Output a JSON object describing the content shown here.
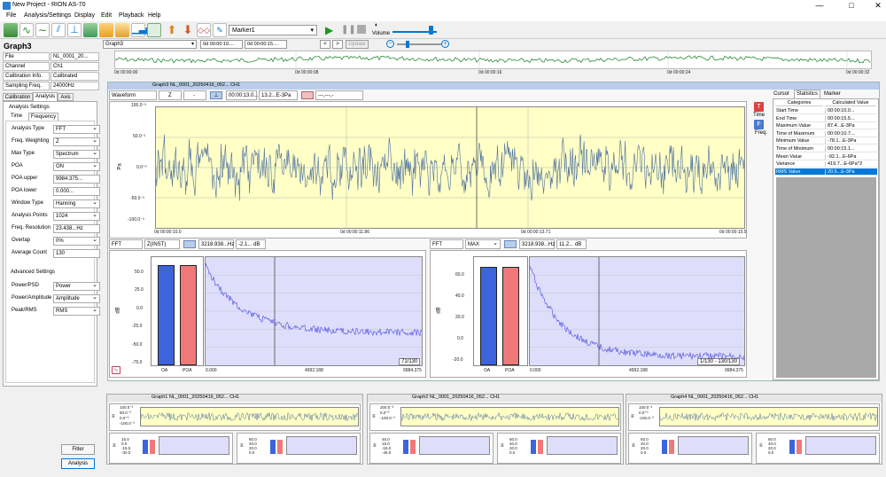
{
  "window": {
    "title": "New Project - RION AS-70",
    "min": "—",
    "max": "□",
    "close": "✕"
  },
  "menu": [
    "File",
    "Analysis/Settings",
    "Display",
    "Edit",
    "Playback",
    "Help"
  ],
  "toolbar": {
    "marker_select": "Marker1",
    "volume_label": "Volume"
  },
  "overview": {
    "graph_select": "Graph3",
    "time_box": "0d 00:00:10....",
    "time_box2": "0d 00:00:15....",
    "update": "Update",
    "ticks": [
      "0d 00:00:00",
      "0d 00:00:08",
      "0d 00:00:16",
      "0d 00:00:24",
      "0d 00:00:32"
    ]
  },
  "left": {
    "title": "Graph3",
    "info": [
      {
        "k": "File",
        "v": "NL_0001_20..."
      },
      {
        "k": "Channel",
        "v": "Ch1"
      },
      {
        "k": "Calibration Info.",
        "v": "Calibrated"
      },
      {
        "k": "Sampling Freq.",
        "v": "24000Hz"
      }
    ],
    "tabs": [
      "Calibration",
      "Analysis",
      "Axis"
    ],
    "section": "Analysis Settings",
    "subtabs": [
      "Time",
      "Frequency"
    ],
    "settings": [
      {
        "k": "Analysis Type",
        "v": "FFT"
      },
      {
        "k": "Freq. Weighting",
        "v": "Z"
      },
      {
        "k": "Max Type",
        "v": "Spectrum"
      },
      {
        "k": "POA",
        "v": "ON"
      },
      {
        "k": "POA upper",
        "v": "9984.375..."
      },
      {
        "k": "POA lower",
        "v": "0.000..."
      },
      {
        "k": "Window Type",
        "v": "Hanning"
      },
      {
        "k": "Analysis Points",
        "v": "1024"
      },
      {
        "k": "Freq. Resolution",
        "v": "23.438...Hz"
      },
      {
        "k": "Overlap",
        "v": "0%"
      },
      {
        "k": "Average Count",
        "v": "130"
      }
    ],
    "adv_title": "Advanced Settings",
    "advanced": [
      {
        "k": "Power/PSD",
        "v": "Power"
      },
      {
        "k": "Power/Amplitude",
        "v": "Amplitude"
      },
      {
        "k": "Peak/RMS",
        "v": "RMS"
      }
    ],
    "filter_btn": "Filter",
    "analysis_btn": "Analysis"
  },
  "graph3": {
    "title": "Graph3 NL_0001_20250416_052... CH1",
    "type": "Waveform",
    "weight": "Z",
    "dash": "-",
    "time": "00:00:13.0...",
    "value": "13.2...E-3Pa",
    "dashes": "---,---,-",
    "yticks": [
      "100.0⁻³",
      "50.0⁻³",
      "0.0⁺⁰",
      "-50.0⁻³",
      "-100.0⁻³"
    ],
    "xticks": [
      "0d 00:00:10.0",
      "0d 00:00:11.86",
      "0d 00:00:13.71",
      "0d 00:00:15.5"
    ],
    "ylabel": "Pa",
    "time_btn": "Time",
    "freq_btn": "Freq."
  },
  "fft1": {
    "type": "FFT",
    "weight": "Z(INST)",
    "freq": "3218.938...Hz",
    "db": "-2.1... dB",
    "yticks": [
      "50.0",
      "25.0",
      "0.0",
      "-25.0",
      "-50.0",
      "-75.0"
    ],
    "xticks": [
      "0.000",
      "4992.188",
      "9984.375"
    ],
    "bars": [
      "OA",
      "POA"
    ],
    "counter": "71/130",
    "ylabel": "dB"
  },
  "fft2": {
    "type": "FFT",
    "weight": "MAX",
    "freq": "3218.938...Hz",
    "db": "11.2... dB",
    "yticks": [
      "60.0",
      "40.0",
      "20.0",
      "0.0",
      "-20.0"
    ],
    "xticks": [
      "0.000",
      "4992.188",
      "9984.375"
    ],
    "bars": [
      "OA",
      "POA"
    ],
    "counter": "1/130 - 130/130",
    "ylabel": "dB"
  },
  "stats": {
    "tabs": [
      "Cursor",
      "Statistics",
      "Marker"
    ],
    "headers": [
      "Categories",
      "Calculated Value"
    ],
    "rows": [
      {
        "k": "Start Time",
        "v": "00:00:10.0..."
      },
      {
        "k": "End Time",
        "v": "00:00:15.5..."
      },
      {
        "k": "Maximum Value",
        "v": "87.4...E-3Pa"
      },
      {
        "k": "Time of Maximum",
        "v": "00:00:10.7..."
      },
      {
        "k": "Minimum Value",
        "v": "-78.1...E-3Pa"
      },
      {
        "k": "Time of Minimum",
        "v": "00:00:15.1..."
      },
      {
        "k": "Mean Value",
        "v": "-92.1...E-6Pa"
      },
      {
        "k": "Variance",
        "v": "419.7...E-6Pa^2"
      },
      {
        "k": "RMS Value",
        "v": "20.5...E-3Pa"
      }
    ]
  },
  "minis": [
    {
      "title": "Graph1 NL_0001_20250416_052... CH1",
      "ticks": [
        "100.0⁻³",
        "50.0⁻³",
        "0.0⁺⁰",
        "-100.0⁻³"
      ],
      "sticks": [
        "15.0",
        "0.0",
        "-15.0",
        "-30.0"
      ],
      "sticks2": [
        "60.0",
        "40.0",
        "20.0",
        "0.0"
      ]
    },
    {
      "title": "Graph2 NL_0001_20250416_052... CH1",
      "ticks": [
        "200.0⁻³",
        "0.0⁺⁰",
        "-100.0⁻³"
      ],
      "sticks": [
        "45.0",
        "15.0",
        "-15.0",
        "-45.0"
      ],
      "sticks2": [
        "60.0",
        "40.0",
        "20.0",
        "0.0"
      ]
    },
    {
      "title": "Graph4 NL_0001_20250416_052... CH1",
      "ticks": [
        "100.0⁻³",
        "0.0⁺⁰",
        "-100.0⁻³"
      ],
      "sticks": [
        "60.0",
        "40.0",
        "20.0",
        "0.0"
      ],
      "sticks2": [
        "60.0",
        "40.0",
        "20.0",
        "0.0"
      ]
    }
  ],
  "colors": {
    "accent": "#0078d7",
    "wave": "#4a6ea0",
    "spectrum": "#4a4ae0",
    "oa": "#3c64dc",
    "poa": "#f07878",
    "plot": "#ffffc6",
    "spec": "#dedefb"
  }
}
